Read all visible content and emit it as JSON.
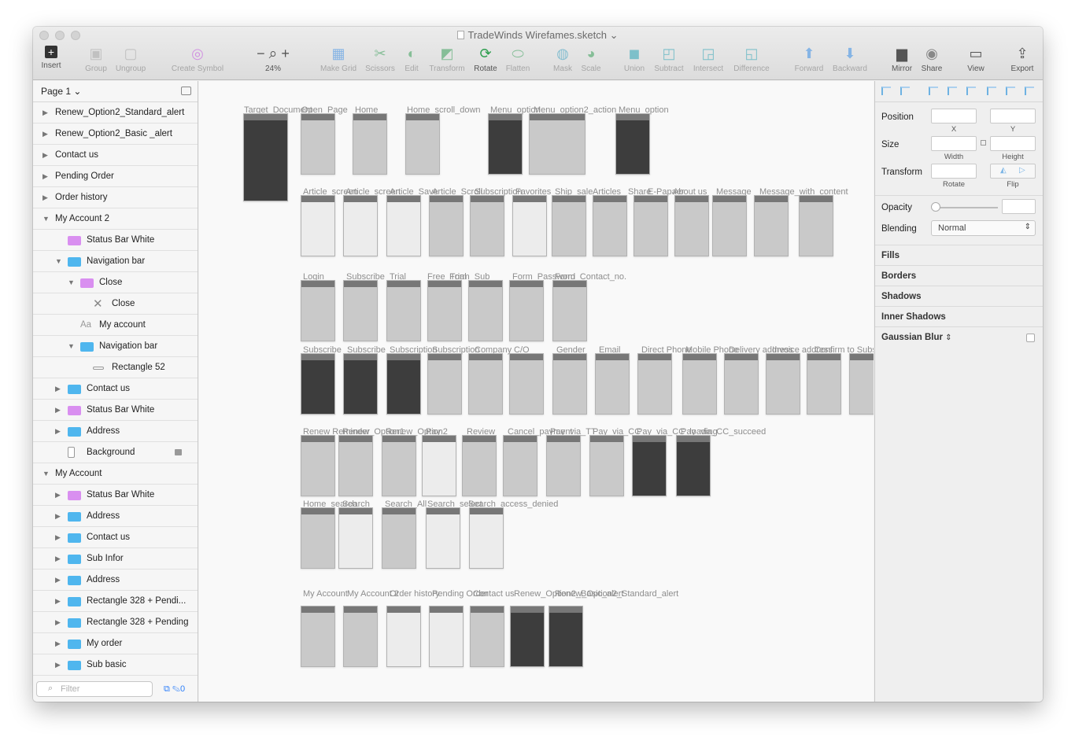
{
  "title": "TradeWinds Wirefames.sketch",
  "toolbar": {
    "insert": "Insert",
    "group": "Group",
    "ungroup": "Ungroup",
    "create_symbol": "Create Symbol",
    "zoom": "24%",
    "make_grid": "Make Grid",
    "scissors": "Scissors",
    "edit": "Edit",
    "transform": "Transform",
    "rotate": "Rotate",
    "flatten": "Flatten",
    "mask": "Mask",
    "scale": "Scale",
    "union": "Union",
    "subtract": "Subtract",
    "intersect": "Intersect",
    "difference": "Difference",
    "forward": "Forward",
    "backward": "Backward",
    "mirror": "Mirror",
    "share": "Share",
    "view": "View",
    "export": "Export"
  },
  "sidebar": {
    "page": "Page 1",
    "layers": [
      {
        "label": "Renew_Option2_Standard_alert"
      },
      {
        "label": "Renew_Option2_Basic _alert"
      },
      {
        "label": "Contact us"
      },
      {
        "label": "Pending Order"
      },
      {
        "label": "Order history"
      },
      {
        "label": "My Account 2"
      },
      {
        "label": "Status Bar White"
      },
      {
        "label": "Navigation bar"
      },
      {
        "label": "Close"
      },
      {
        "label": "Close"
      },
      {
        "label": "My account"
      },
      {
        "label": "Navigation bar"
      },
      {
        "label": "Rectangle 52"
      },
      {
        "label": "Contact us"
      },
      {
        "label": "Status Bar White"
      },
      {
        "label": "Address"
      },
      {
        "label": "Background"
      },
      {
        "label": "My Account"
      },
      {
        "label": "Status Bar White"
      },
      {
        "label": "Address"
      },
      {
        "label": "Contact us"
      },
      {
        "label": "Sub Infor"
      },
      {
        "label": "Address"
      },
      {
        "label": "Rectangle 328 + Pendi..."
      },
      {
        "label": "Rectangle 328 + Pending"
      },
      {
        "label": "My order"
      },
      {
        "label": "Sub basic"
      }
    ],
    "filter_placeholder": "Filter",
    "filter_count": "0"
  },
  "canvas": {
    "labels": [
      "Target_Document",
      "Open_Page",
      "Home",
      "Home_scroll_down",
      "Menu_option",
      "Menu_option2_action",
      "Menu_option",
      "Article_screen",
      "Article_screen",
      "Article_Save",
      "Article_Scroll",
      "Subscription",
      "Favorites",
      "Ship_sale",
      "Articles",
      "Share",
      "E-Papaer",
      "About us",
      "Message",
      "Message_with_content",
      "Login",
      "Subscribe",
      "Trial",
      "Free_Trial",
      "Form_Sub",
      "Form_Password",
      "Form_Contact_no.",
      "Subscribe",
      "Subscribe",
      "Subscription",
      "Subscription",
      "Company",
      "C/O",
      "Gender",
      "Email",
      "Direct Phone",
      "Mobile Phone",
      "Delivery address",
      "Invoice address",
      "Confirm to Subs",
      "Renew Reminder",
      "Renew_Option1",
      "Renew_Option2",
      "Pay",
      "Review",
      "Cancel_payment",
      "Pay_via_TT",
      "Pay_via_CC",
      "Pay_via_CC_loading",
      "Pay_via_CC_succeed",
      "Home_search",
      "Search",
      "Search_All",
      "Search_select",
      "Search_access_denied",
      "My Account",
      "My Account 2",
      "Order history",
      "Pending Order",
      "Contact us",
      "Renew_Option2_Basic_alert",
      "Renew_Option2_Standard_alert"
    ]
  },
  "inspector": {
    "position": "Position",
    "x": "X",
    "y": "Y",
    "size": "Size",
    "width": "Width",
    "height": "Height",
    "transform": "Transform",
    "rotate": "Rotate",
    "flip": "Flip",
    "opacity": "Opacity",
    "blending": "Blending",
    "blend_mode": "Normal",
    "fills": "Fills",
    "borders": "Borders",
    "shadows": "Shadows",
    "inner_shadows": "Inner Shadows",
    "gaussian_blur": "Gaussian Blur"
  }
}
